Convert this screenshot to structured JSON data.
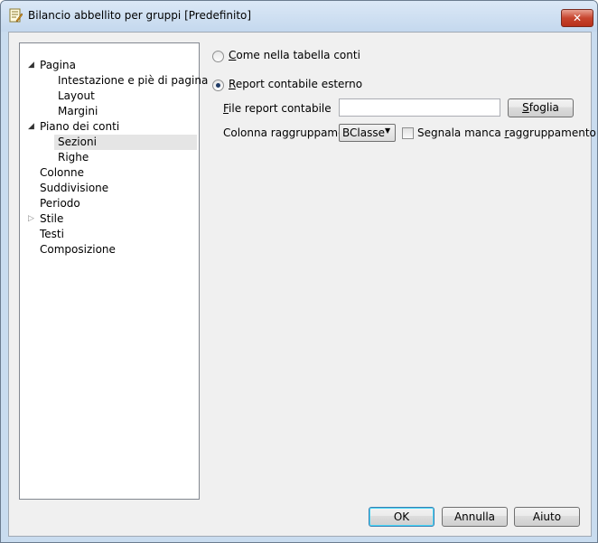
{
  "window": {
    "title": "Bilancio abbellito per gruppi [Predefinito]",
    "close_label": "✕"
  },
  "tree": {
    "items": [
      {
        "label": "Pagina",
        "expander": "expanded"
      },
      {
        "label": "Intestazione e piè di pagina"
      },
      {
        "label": "Layout"
      },
      {
        "label": "Margini"
      },
      {
        "label": "Piano dei conti",
        "expander": "expanded"
      },
      {
        "label": "Sezioni",
        "selected": true
      },
      {
        "label": "Righe"
      },
      {
        "label": "Colonne"
      },
      {
        "label": "Suddivisione"
      },
      {
        "label": "Periodo"
      },
      {
        "label": "Stile",
        "expander": "collapsed"
      },
      {
        "label": "Testi"
      },
      {
        "label": "Composizione"
      }
    ]
  },
  "options": {
    "radio_table": {
      "label_first": "C",
      "label_rest": "ome nella tabella conti",
      "checked": false
    },
    "radio_external": {
      "label_first": "R",
      "label_rest": "eport contabile esterno",
      "checked": true
    },
    "file_label_first": "F",
    "file_label_rest": "ile report contabile",
    "file_value": "",
    "browse_first": "S",
    "browse_rest": "foglia",
    "group_column_label": "Colonna raggruppamento",
    "group_column_value": "BClasse",
    "missing_group_label_pre": "Segnala manca ",
    "missing_group_label_u": "r",
    "missing_group_label_post": "aggruppamento",
    "missing_group_checked": false
  },
  "buttons": {
    "ok": "OK",
    "cancel": "Annulla",
    "help": "Aiuto"
  },
  "icons": {
    "title": "report-edit-icon",
    "expanded": "triangle-expanded-icon",
    "collapsed": "triangle-collapsed-icon",
    "dropdown": "dropdown-arrow-icon"
  }
}
